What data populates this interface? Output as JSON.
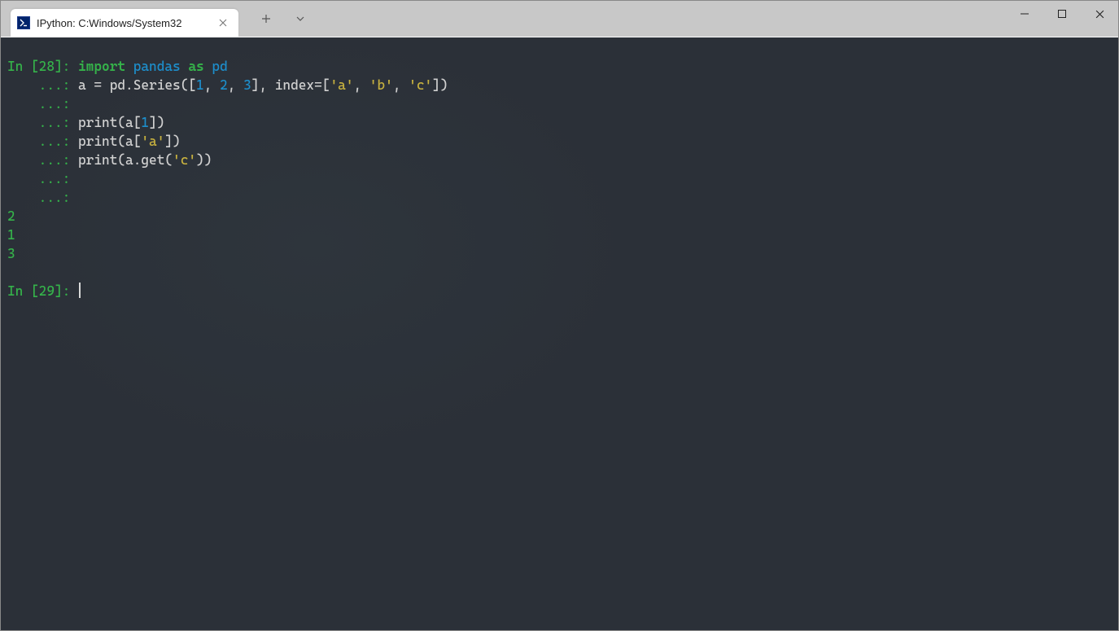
{
  "tab": {
    "title": "IPython: C:Windows/System32",
    "icon_name": "powershell-icon"
  },
  "titlebar_icons": {
    "new_tab": "+",
    "dropdown": "⌄"
  },
  "session": {
    "in_prompt_1": "In [28]: ",
    "cont_prompt": "    ...: ",
    "in_prompt_2": "In [29]: ",
    "code": {
      "l1_import": "import",
      "l1_sp1": " ",
      "l1_pandas": "pandas",
      "l1_sp2": " ",
      "l1_as": "as",
      "l1_sp3": " ",
      "l1_pd": "pd",
      "l2_pre": "a = pd.Series([",
      "l2_n1": "1",
      "l2_c1": ", ",
      "l2_n2": "2",
      "l2_c2": ", ",
      "l2_n3": "3",
      "l2_post1": "], index=[",
      "l2_s1": "'a'",
      "l2_c3": ", ",
      "l2_s2": "'b'",
      "l2_c4": ", ",
      "l2_s3": "'c'",
      "l2_post2": "])",
      "l4_pre": "print(a[",
      "l4_n": "1",
      "l4_post": "])",
      "l5_pre": "print(a[",
      "l5_s": "'a'",
      "l5_post": "])",
      "l6_pre": "print(a.get(",
      "l6_s": "'c'",
      "l6_post": "))"
    },
    "output": {
      "o1": "2",
      "o2": "1",
      "o3": "3"
    }
  }
}
